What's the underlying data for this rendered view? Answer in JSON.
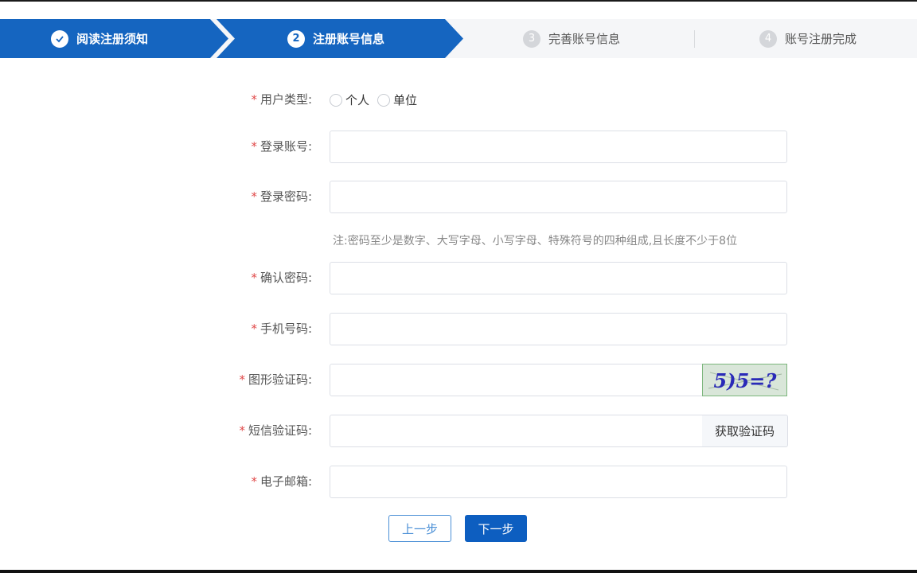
{
  "steps": [
    {
      "num": "",
      "label": "阅读注册须知",
      "state": "done"
    },
    {
      "num": "2",
      "label": "注册账号信息",
      "state": "active"
    },
    {
      "num": "3",
      "label": "完善账号信息",
      "state": "pending"
    },
    {
      "num": "4",
      "label": "账号注册完成",
      "state": "pending"
    }
  ],
  "form": {
    "required_mark": "*",
    "user_type": {
      "label": "用户类型:",
      "options": [
        "个人",
        "单位"
      ]
    },
    "account": {
      "label": "登录账号:",
      "value": ""
    },
    "password": {
      "label": "登录密码:",
      "value": ""
    },
    "password_note": "注:密码至少是数字、大写字母、小写字母、特殊符号的四种组成,且长度不少于8位",
    "confirm_password": {
      "label": "确认密码:",
      "value": ""
    },
    "phone": {
      "label": "手机号码:",
      "value": ""
    },
    "captcha": {
      "label": "图形验证码:",
      "value": "",
      "image_text": "5)5=?"
    },
    "sms_code": {
      "label": "短信验证码:",
      "value": "",
      "button": "获取验证码"
    },
    "email": {
      "label": "电子邮箱:",
      "value": ""
    }
  },
  "buttons": {
    "prev": "上一步",
    "next": "下一步"
  },
  "colors": {
    "primary": "#1565c0",
    "required": "#e04848"
  }
}
